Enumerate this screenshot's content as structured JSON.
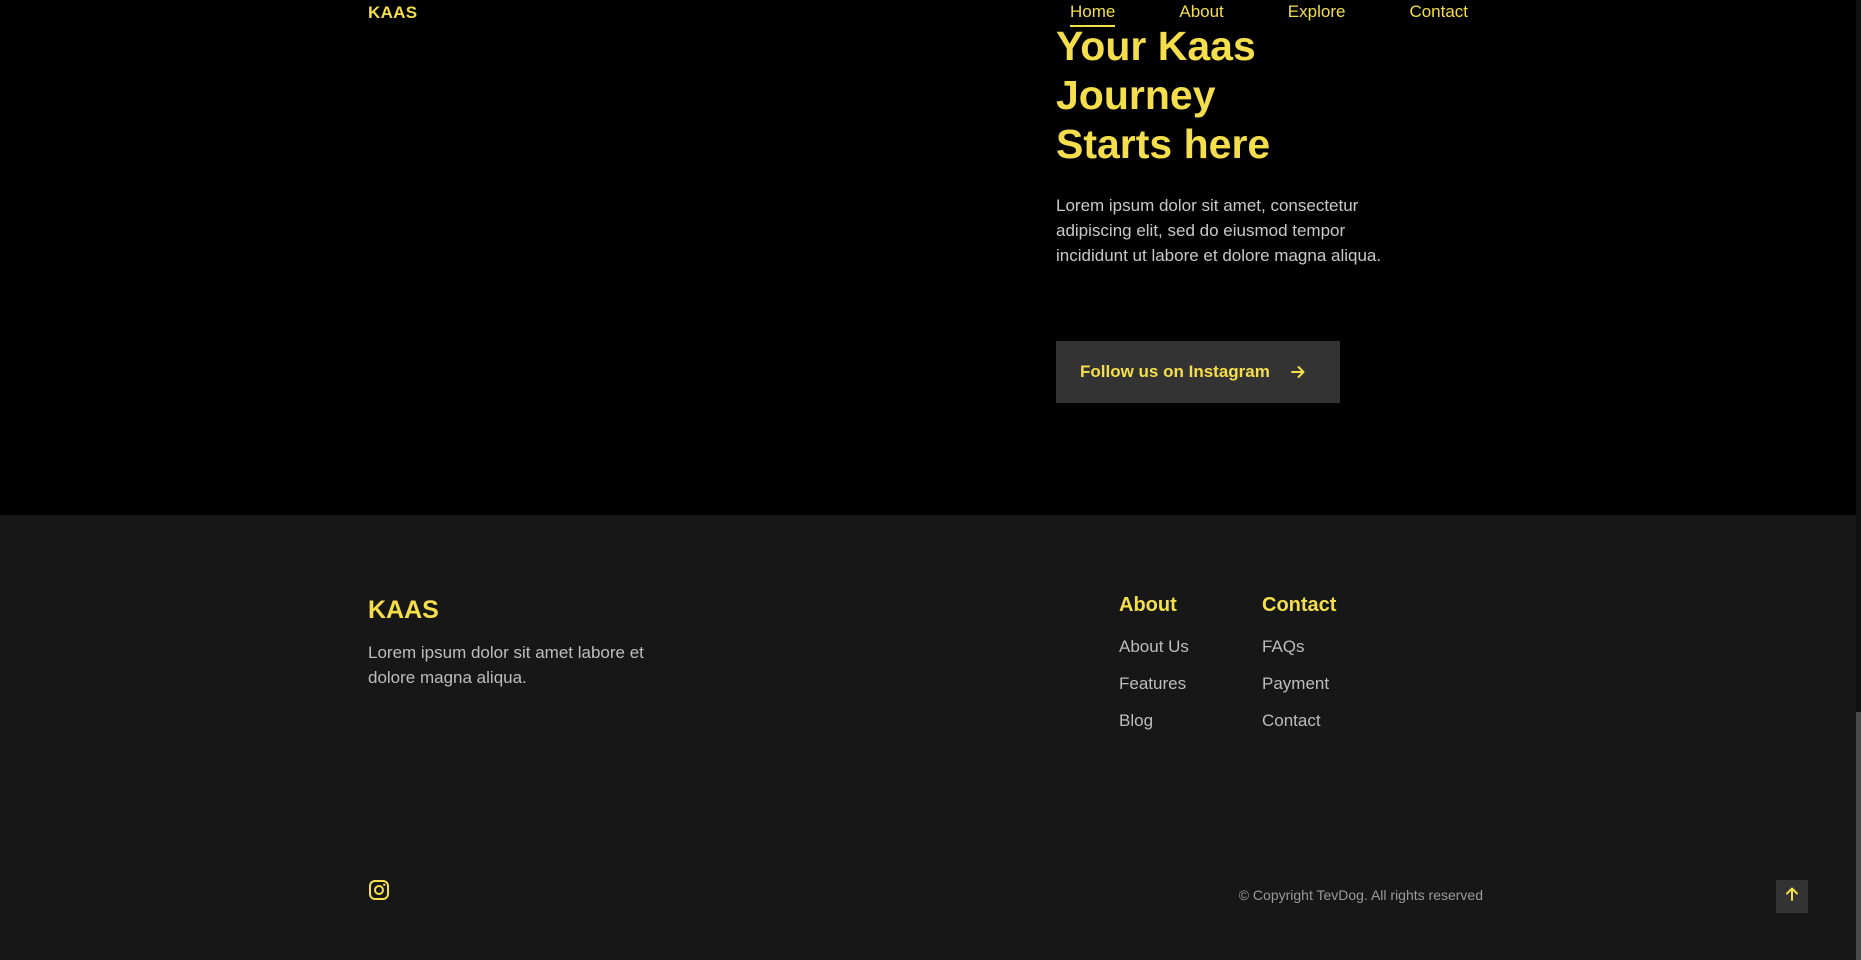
{
  "header": {
    "brand": "KAAS",
    "nav": [
      {
        "label": "Home",
        "active": true
      },
      {
        "label": "About"
      },
      {
        "label": "Explore"
      },
      {
        "label": "Contact"
      }
    ]
  },
  "hero": {
    "title_lines": [
      "Your Kaas",
      "Journey",
      "Starts here"
    ],
    "text": "Lorem ipsum dolor sit amet, consectetur adipiscing elit, sed do eiusmod tempor incididunt ut labore et dolore magna aliqua.",
    "cta_label": "Follow us on Instagram",
    "cta_icon": "arrow-right-icon"
  },
  "footer": {
    "brand": "KAAS",
    "text": "Lorem ipsum dolor sit amet labore et dolore magna aliqua.",
    "columns": [
      {
        "title": "About",
        "links": [
          "About Us",
          "Features",
          "Blog"
        ]
      },
      {
        "title": "Contact",
        "links": [
          "FAQs",
          "Payment",
          "Contact"
        ]
      }
    ],
    "social_icon": "instagram-icon",
    "copyright": "© Copyright TevDog. All rights reserved"
  },
  "scroll_top_icon": "arrow-up-icon",
  "colors": {
    "accent": "#f5de4c",
    "hero_bg": "#000000",
    "footer_bg": "#171717",
    "button_bg": "#333333",
    "text": "#c9c9c9"
  }
}
